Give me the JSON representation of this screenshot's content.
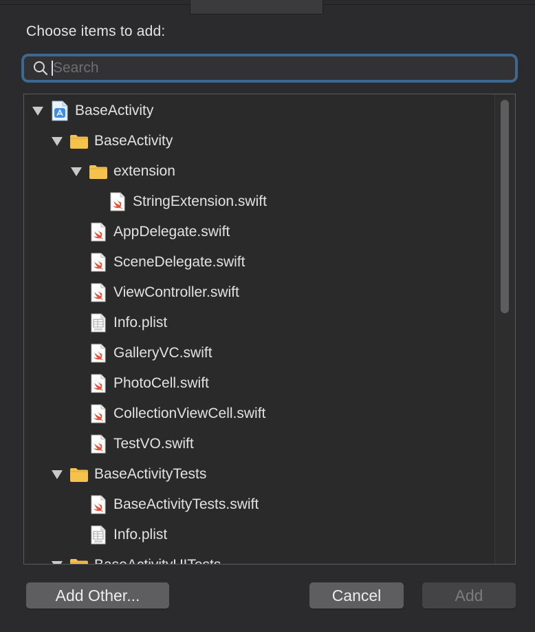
{
  "dialog": {
    "prompt": "Choose items to add:"
  },
  "search": {
    "placeholder": "Search",
    "value": ""
  },
  "tree": [
    {
      "label": "BaseActivity",
      "icon": "project-icon",
      "depth": 0,
      "disclosure": "expanded"
    },
    {
      "label": "BaseActivity",
      "icon": "folder-icon",
      "depth": 1,
      "disclosure": "expanded"
    },
    {
      "label": "extension",
      "icon": "folder-icon",
      "depth": 2,
      "disclosure": "expanded"
    },
    {
      "label": "StringExtension.swift",
      "icon": "swift-file-icon",
      "depth": 3,
      "disclosure": "none"
    },
    {
      "label": "AppDelegate.swift",
      "icon": "swift-file-icon",
      "depth": 2,
      "disclosure": "none"
    },
    {
      "label": "SceneDelegate.swift",
      "icon": "swift-file-icon",
      "depth": 2,
      "disclosure": "none"
    },
    {
      "label": "ViewController.swift",
      "icon": "swift-file-icon",
      "depth": 2,
      "disclosure": "none"
    },
    {
      "label": "Info.plist",
      "icon": "plist-file-icon",
      "depth": 2,
      "disclosure": "none"
    },
    {
      "label": "GalleryVC.swift",
      "icon": "swift-file-icon",
      "depth": 2,
      "disclosure": "none"
    },
    {
      "label": "PhotoCell.swift",
      "icon": "swift-file-icon",
      "depth": 2,
      "disclosure": "none"
    },
    {
      "label": "CollectionViewCell.swift",
      "icon": "swift-file-icon",
      "depth": 2,
      "disclosure": "none"
    },
    {
      "label": "TestVO.swift",
      "icon": "swift-file-icon",
      "depth": 2,
      "disclosure": "none"
    },
    {
      "label": "BaseActivityTests",
      "icon": "folder-icon",
      "depth": 1,
      "disclosure": "expanded"
    },
    {
      "label": "BaseActivityTests.swift",
      "icon": "swift-file-icon",
      "depth": 2,
      "disclosure": "none"
    },
    {
      "label": "Info.plist",
      "icon": "plist-file-icon",
      "depth": 2,
      "disclosure": "none"
    },
    {
      "label": "BaseActivityUITests",
      "icon": "folder-icon",
      "depth": 1,
      "disclosure": "expanded"
    }
  ],
  "buttons": {
    "add_other": "Add Other...",
    "cancel": "Cancel",
    "add": "Add"
  },
  "colors": {
    "folder": "#f5c24c",
    "swift": "#e9503a",
    "project": "#3d8fe6",
    "focus_ring": "#3d6890"
  }
}
